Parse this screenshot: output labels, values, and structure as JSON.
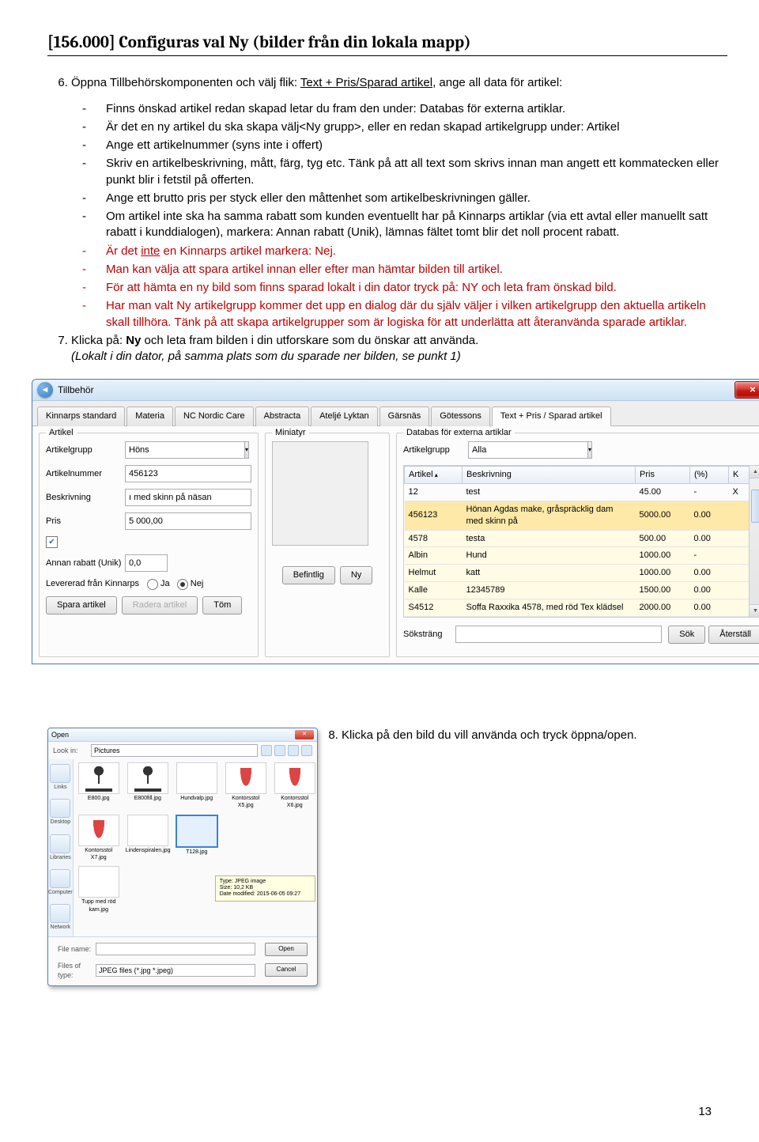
{
  "heading": "[156.000] Configuras val Ny (bilder från din lokala mapp)",
  "item6": {
    "lead_a": "Öppna Tillbehörskomponenten och välj flik: ",
    "lead_link": "Text + Pris/Sparad artikel",
    "lead_b": ", ange all data för artikel:",
    "bullets": [
      "Finns önskad artikel redan skapad letar du fram den under: Databas för externa artiklar.",
      "Är det en ny artikel du ska skapa välj<Ny grupp>, eller en redan skapad artikelgrupp under: Artikel",
      "Ange ett artikelnummer (syns inte i offert)",
      "Skriv en artikelbeskrivning, mått, färg, tyg etc. Tänk på att all text som skrivs innan man angett ett kommatecken eller punkt blir i fetstil på offerten.",
      "Ange ett brutto pris per styck eller den måttenhet som artikelbeskrivningen gäller.",
      "Om artikel inte ska ha samma rabatt som kunden eventuellt har på Kinnarps artiklar (via ett avtal eller manuellt satt rabatt i kunddialogen), markera: Annan rabatt (Unik), lämnas fältet tomt blir det noll procent rabatt."
    ],
    "red": [
      {
        "pre": "Är det ",
        "u": "inte",
        "post": " en Kinnarps artikel markera: Nej."
      },
      {
        "text": "Man kan välja att spara artikel innan eller efter man hämtar bilden till artikel."
      },
      {
        "text": "För att hämta en ny bild som finns sparad lokalt i din dator tryck på: NY och leta fram önskad bild."
      },
      {
        "text": "Har man valt Ny artikelgrupp kommer det upp en dialog där du själv väljer i vilken artikelgrupp den aktuella artikeln skall tillhöra. Tänk på att skapa artikelgrupper som är logiska för att underlätta att återanvända sparade artiklar."
      }
    ]
  },
  "item7": {
    "a": "Klicka på: ",
    "b": "Ny",
    "c": " och leta fram bilden i din utforskare som du önskar att använda.",
    "note": "(Lokalt i din dator, på samma plats som du sparade ner bilden, se punkt 1)"
  },
  "win": {
    "title": "Tillbehör",
    "tabs": [
      "Kinnarps standard",
      "Materia",
      "NC Nordic Care",
      "Abstracta",
      "Ateljé Lyktan",
      "Gärsnäs",
      "Götessons",
      "Text + Pris / Sparad artikel"
    ],
    "artikel": {
      "group": "Artikel",
      "labels": {
        "grupp": "Artikelgrupp",
        "nummer": "Artikelnummer",
        "beskr": "Beskrivning",
        "pris": "Pris",
        "rabatt": "Annan rabatt (Unik)",
        "lever": "Levererad från Kinnarps",
        "ja": "Ja",
        "nej": "Nej"
      },
      "values": {
        "grupp": "Höns",
        "nummer": "456123",
        "beskr": "ı med skinn på näsan",
        "pris": "5 000,00",
        "rabatt": "0,0"
      },
      "btns": {
        "spara": "Spara artikel",
        "radera": "Radera artikel",
        "tom": "Töm"
      }
    },
    "mini": {
      "group": "Miniatyr",
      "befintlig": "Befintlig",
      "ny": "Ny"
    },
    "db": {
      "group": "Databas för externa artiklar",
      "grupp_label": "Artikelgrupp",
      "grupp_value": "Alla",
      "cols": {
        "artikel": "Artikel",
        "beskr": "Beskrivning",
        "pris": "Pris",
        "pct": "(%)",
        "k": "K"
      },
      "rows": [
        {
          "a": "12",
          "b": "test",
          "p": "45.00",
          "pc": "-",
          "k": "X"
        },
        {
          "a": "456123",
          "b": "Hönan Agdas make, gråspräcklig dam med skinn på",
          "p": "5000.00",
          "pc": "0.00",
          "k": ""
        },
        {
          "a": "4578",
          "b": "testa",
          "p": "500.00",
          "pc": "0.00",
          "k": ""
        },
        {
          "a": "Albin",
          "b": "Hund",
          "p": "1000.00",
          "pc": "-",
          "k": ""
        },
        {
          "a": "Helmut",
          "b": "katt",
          "p": "1000.00",
          "pc": "0.00",
          "k": ""
        },
        {
          "a": "Kalle",
          "b": "12345789",
          "p": "1500.00",
          "pc": "0.00",
          "k": ""
        },
        {
          "a": "S4512",
          "b": "Soffa Raxxika 4578, med röd Tex klädsel",
          "p": "2000.00",
          "pc": "0.00",
          "k": ""
        }
      ],
      "sok_label": "Söksträng",
      "sok": "Sök",
      "aterstall": "Återställ"
    }
  },
  "item8": "Klicka på den bild du vill använda och tryck öppna/open.",
  "open": {
    "title": "Open",
    "lookin": "Look in:",
    "lookin_val": "Pictures",
    "places": [
      "Links",
      "Desktop",
      "Libraries",
      "Computer",
      "Network"
    ],
    "thumbs": [
      [
        "E800.jpg",
        "E800fill.jpg",
        "Hundvalp.jpg",
        "Kontorsstol X5.jpg",
        "Kontorsstol X6.jpg"
      ],
      [
        "Kontorsstol X7.jpg",
        "Lindenspiralen.jpg",
        "T128.jpg"
      ],
      [
        "Tupp med röd kam.jpg"
      ]
    ],
    "tip": {
      "l1": "Type: JPEG image",
      "l2": "Size: 10,2 KB",
      "l3": "Date modified: 2015-06-05 09:27"
    },
    "filename_l": "File name:",
    "filename_v": "",
    "filetype_l": "Files of type:",
    "filetype_v": "JPEG files (*.jpg *.jpeg)",
    "open_btn": "Open",
    "cancel_btn": "Cancel"
  },
  "page": "13"
}
